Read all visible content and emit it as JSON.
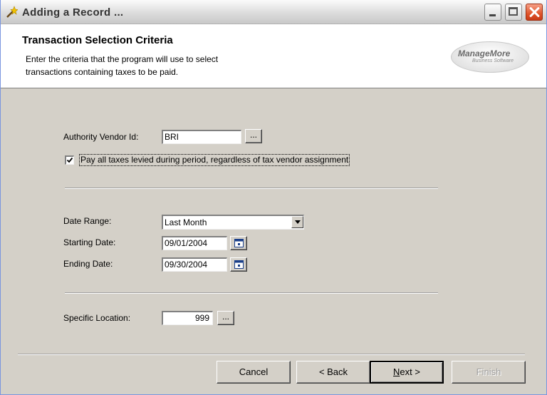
{
  "window": {
    "title": "Adding a Record ..."
  },
  "header": {
    "title": "Transaction Selection Criteria",
    "description": "Enter the criteria that the program will use to select transactions containing taxes to be paid.",
    "logo": {
      "main": "ManageMore",
      "sub": "Business Software"
    }
  },
  "form": {
    "authority_vendor": {
      "label": "Authority Vendor Id:",
      "value": "BRI",
      "browse_label": "..."
    },
    "pay_all_taxes": {
      "label": "Pay all taxes levied during period, regardless of tax vendor assignment",
      "checked": true
    },
    "date_range": {
      "label": "Date Range:",
      "value": "Last Month"
    },
    "starting_date": {
      "label": "Starting Date:",
      "value": "09/01/2004"
    },
    "ending_date": {
      "label": "Ending Date:",
      "value": "09/30/2004"
    },
    "specific_location": {
      "label": "Specific Location:",
      "value": "999",
      "browse_label": "..."
    }
  },
  "buttons": {
    "cancel": "Cancel",
    "back": "< Back",
    "next": "Next >",
    "finish": "Finish"
  },
  "colors": {
    "dialog_face": "#d4d0c8",
    "close_button": "#e0542a"
  }
}
